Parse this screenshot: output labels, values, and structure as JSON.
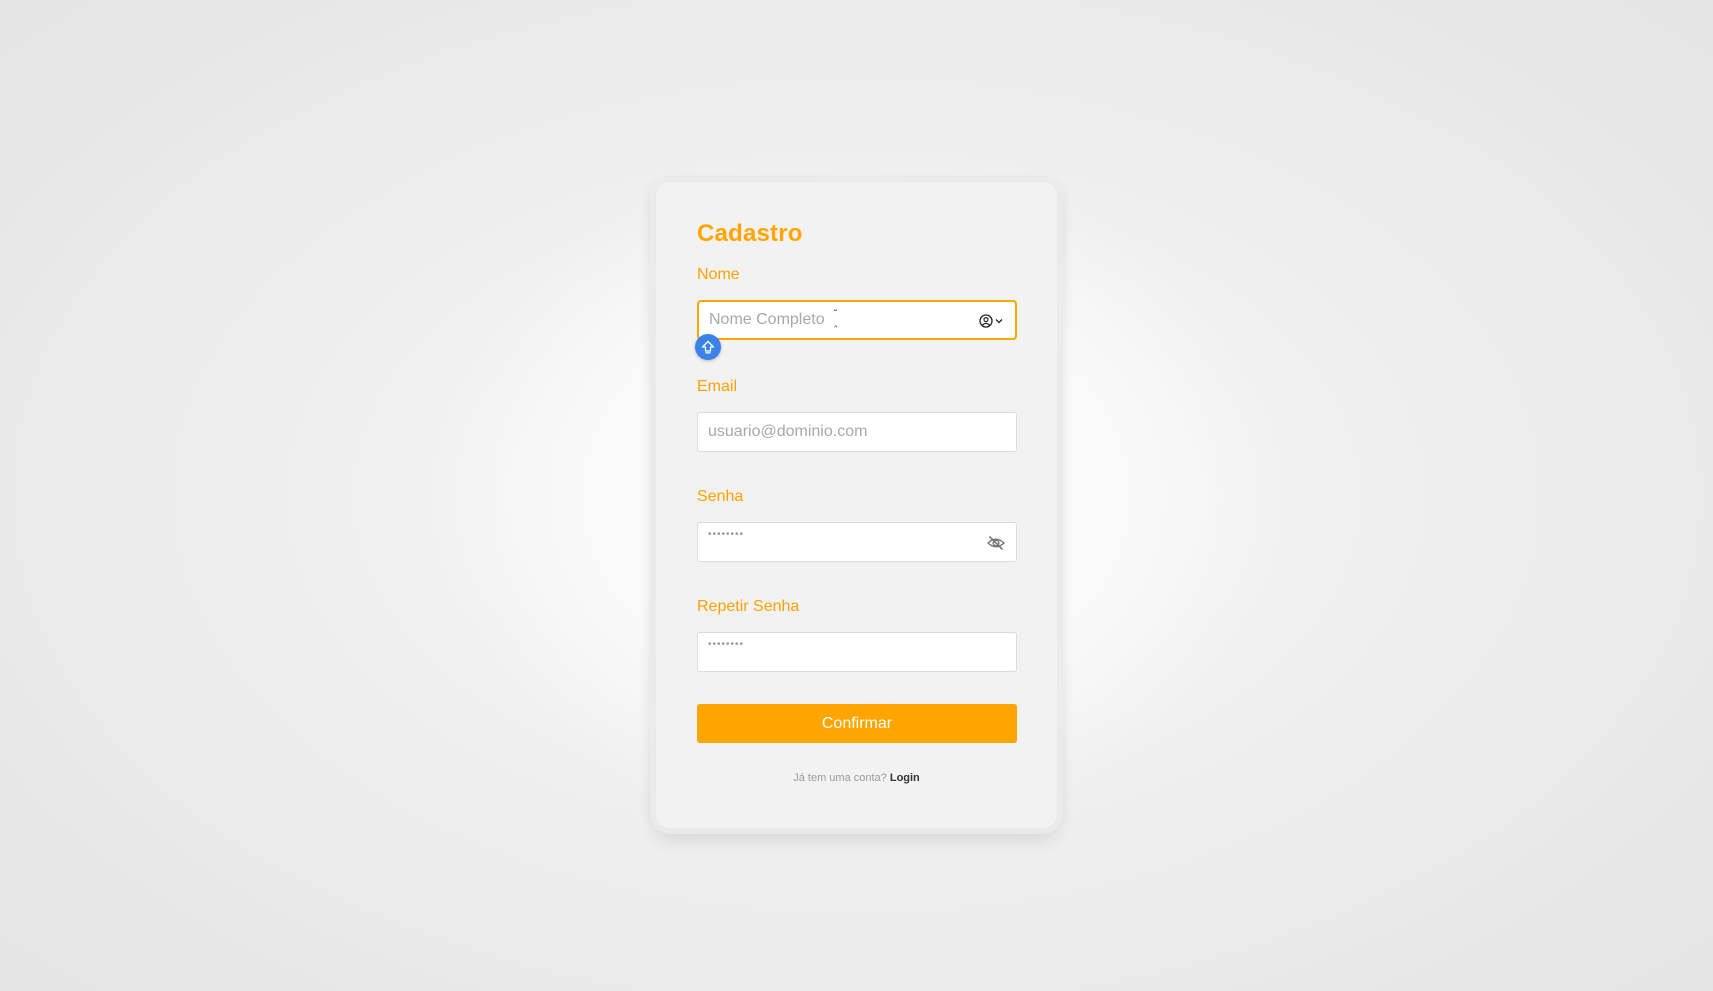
{
  "form": {
    "title": "Cadastro",
    "name_label": "Nome",
    "name_placeholder": "Nome Completo",
    "email_label": "Email",
    "email_placeholder": "usuario@dominio.com",
    "password_label": "Senha",
    "password_placeholder": "••••••••",
    "repeat_password_label": "Repetir Senha",
    "repeat_password_placeholder": "••••••••",
    "confirm_label": "Confirmar",
    "footer_prompt": "Já tem uma conta?",
    "login_link": "Login"
  },
  "icons": {
    "name_field_icon": "profile-autofill-icon",
    "password_field_icon": "eye-slash-icon",
    "autofill_badge": "key-icon"
  },
  "colors": {
    "accent": "#ffa500",
    "badge": "#3b82e8",
    "card_background": "#f2f2f2"
  }
}
